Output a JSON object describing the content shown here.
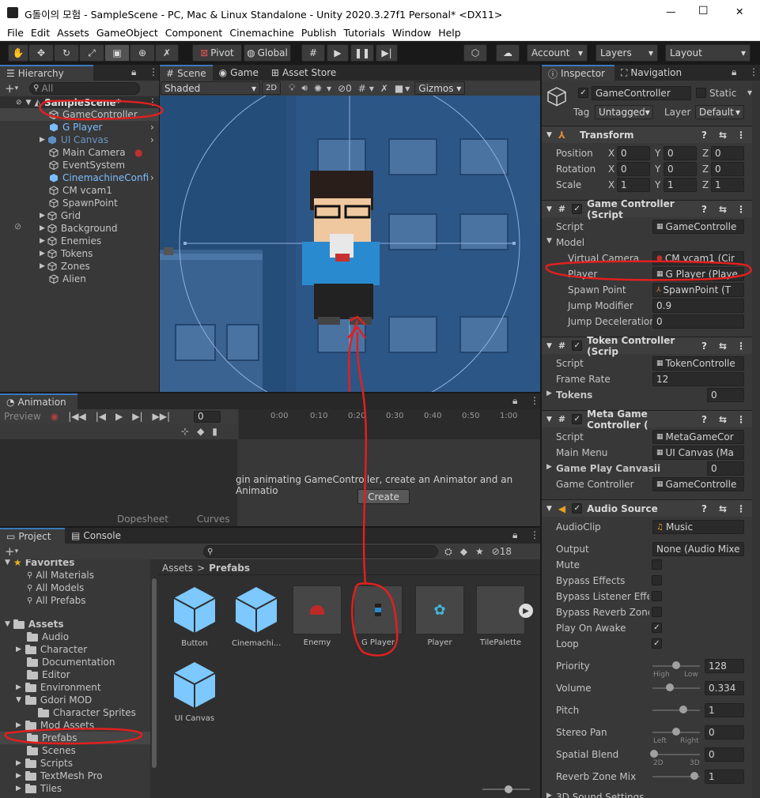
{
  "window": {
    "title": "G돌이의 모험 - SampleScene - PC, Mac & Linux Standalone - Unity 2020.3.27f1 Personal* <DX11>",
    "min": "—",
    "max": "☐",
    "close": "✕"
  },
  "menu": [
    "File",
    "Edit",
    "Assets",
    "GameObject",
    "Component",
    "Cinemachine",
    "Publish",
    "Tutorials",
    "Window",
    "Help"
  ],
  "toolbar": {
    "pivot": "Pivot",
    "global": "Global",
    "account": "Account",
    "layers": "Layers",
    "layout": "Layout"
  },
  "hierarchy": {
    "tab": "Hierarchy",
    "search_placeholder": "All",
    "scene": "SampleScene*",
    "items": [
      "GameController",
      "G Player",
      "UI Canvas",
      "Main Camera",
      "EventSystem",
      "CinemachineConfi",
      "CM vcam1",
      "SpawnPoint",
      "Grid",
      "Background",
      "Enemies",
      "Tokens",
      "Zones",
      "Alien"
    ]
  },
  "scene": {
    "tabs": [
      "Scene",
      "Game",
      "Asset Store"
    ],
    "shading": "Shaded",
    "mode2d": "2D",
    "hidden_count": "0",
    "gizmos": "Gizmos"
  },
  "animation": {
    "tab": "Animation",
    "preview": "Preview",
    "frame": "0",
    "ticks": [
      "0:00",
      "0:10",
      "0:20",
      "0:30",
      "0:40",
      "0:50",
      "1:00"
    ],
    "message": "gin animating GameController, create an Animator and an Animatio",
    "create": "Create",
    "dopesheet": "Dopesheet",
    "curves": "Curves"
  },
  "project": {
    "tabs": [
      "Project",
      "Console"
    ],
    "count": "18",
    "favorites": "Favorites",
    "fav_items": [
      "All Materials",
      "All Models",
      "All Prefabs"
    ],
    "assets": "Assets",
    "folders": [
      "Audio",
      "Character",
      "Documentation",
      "Editor",
      "Environment",
      "Gdori MOD",
      "Character Sprites",
      "Mod Assets",
      "Prefabs",
      "Scenes",
      "Scripts",
      "TextMesh Pro",
      "Tiles"
    ],
    "breadcrumb_root": "Assets",
    "breadcrumb_sep": ">",
    "breadcrumb_current": "Prefabs",
    "prefabs": [
      "Button",
      "Cinemachi...",
      "Enemy",
      "G Player",
      "Player",
      "TilePalette",
      "UI Canvas"
    ]
  },
  "inspector": {
    "tabs": [
      "Inspector",
      "Navigation"
    ],
    "object_name": "GameController",
    "static": "Static",
    "tag_label": "Tag",
    "tag": "Untagged",
    "layer_label": "Layer",
    "layer": "Default",
    "transform": {
      "title": "Transform",
      "position": "Position",
      "rotation": "Rotation",
      "scale": "Scale",
      "x": "X",
      "y": "Y",
      "z": "Z",
      "pos": [
        "0",
        "0",
        "0"
      ],
      "rot": [
        "0",
        "0",
        "0"
      ],
      "scl": [
        "1",
        "1",
        "1"
      ]
    },
    "game_controller": {
      "title": "Game Controller (Script",
      "script_label": "Script",
      "script": "GameControlle",
      "model": "Model",
      "vcam_label": "Virtual Camera",
      "vcam": "CM vcam1 (Cir",
      "player_label": "Player",
      "player": "G Player (Playe",
      "spawn_label": "Spawn Point",
      "spawn": "SpawnPoint (T",
      "jump_mod_label": "Jump Modifier",
      "jump_mod": "0.9",
      "jump_dec_label": "Jump Deceleration",
      "jump_dec": "0"
    },
    "token_controller": {
      "title": "Token Controller (Scrip",
      "script_label": "Script",
      "script": "TokenControlle",
      "frame_rate_label": "Frame Rate",
      "frame_rate": "12",
      "tokens_label": "Tokens",
      "tokens": "0"
    },
    "meta": {
      "title": "Meta Game Controller (",
      "script_label": "Script",
      "script": "MetaGameCor",
      "main_menu_label": "Main Menu",
      "main_menu": "UI Canvas (Ma",
      "gp_label": "Game Play Canvasii",
      "gp": "0",
      "gc_label": "Game Controller",
      "gc": "GameControlle"
    },
    "audio": {
      "title": "Audio Source",
      "clip_label": "AudioClip",
      "clip": "Music",
      "output_label": "Output",
      "output": "None (Audio Mixe",
      "mute": "Mute",
      "bypass_effects": "Bypass Effects",
      "bypass_listener": "Bypass Listener Effec",
      "bypass_reverb": "Bypass Reverb Zones",
      "play_on_awake": "Play On Awake",
      "loop": "Loop",
      "priority_label": "Priority",
      "priority": "128",
      "high": "High",
      "low": "Low",
      "volume_label": "Volume",
      "volume": "0.334",
      "pitch_label": "Pitch",
      "pitch": "1",
      "stereo_label": "Stereo Pan",
      "stereo": "0",
      "left": "Left",
      "right": "Right",
      "spatial_label": "Spatial Blend",
      "spatial": "0",
      "d2": "2D",
      "d3": "3D",
      "reverb_label": "Reverb Zone Mix",
      "reverb": "1",
      "sound3d": "3D Sound Settings"
    }
  },
  "colors": {
    "accent": "#3a79bb",
    "annotation": "#e0201f",
    "prefab_blue": "#7cbdff"
  }
}
